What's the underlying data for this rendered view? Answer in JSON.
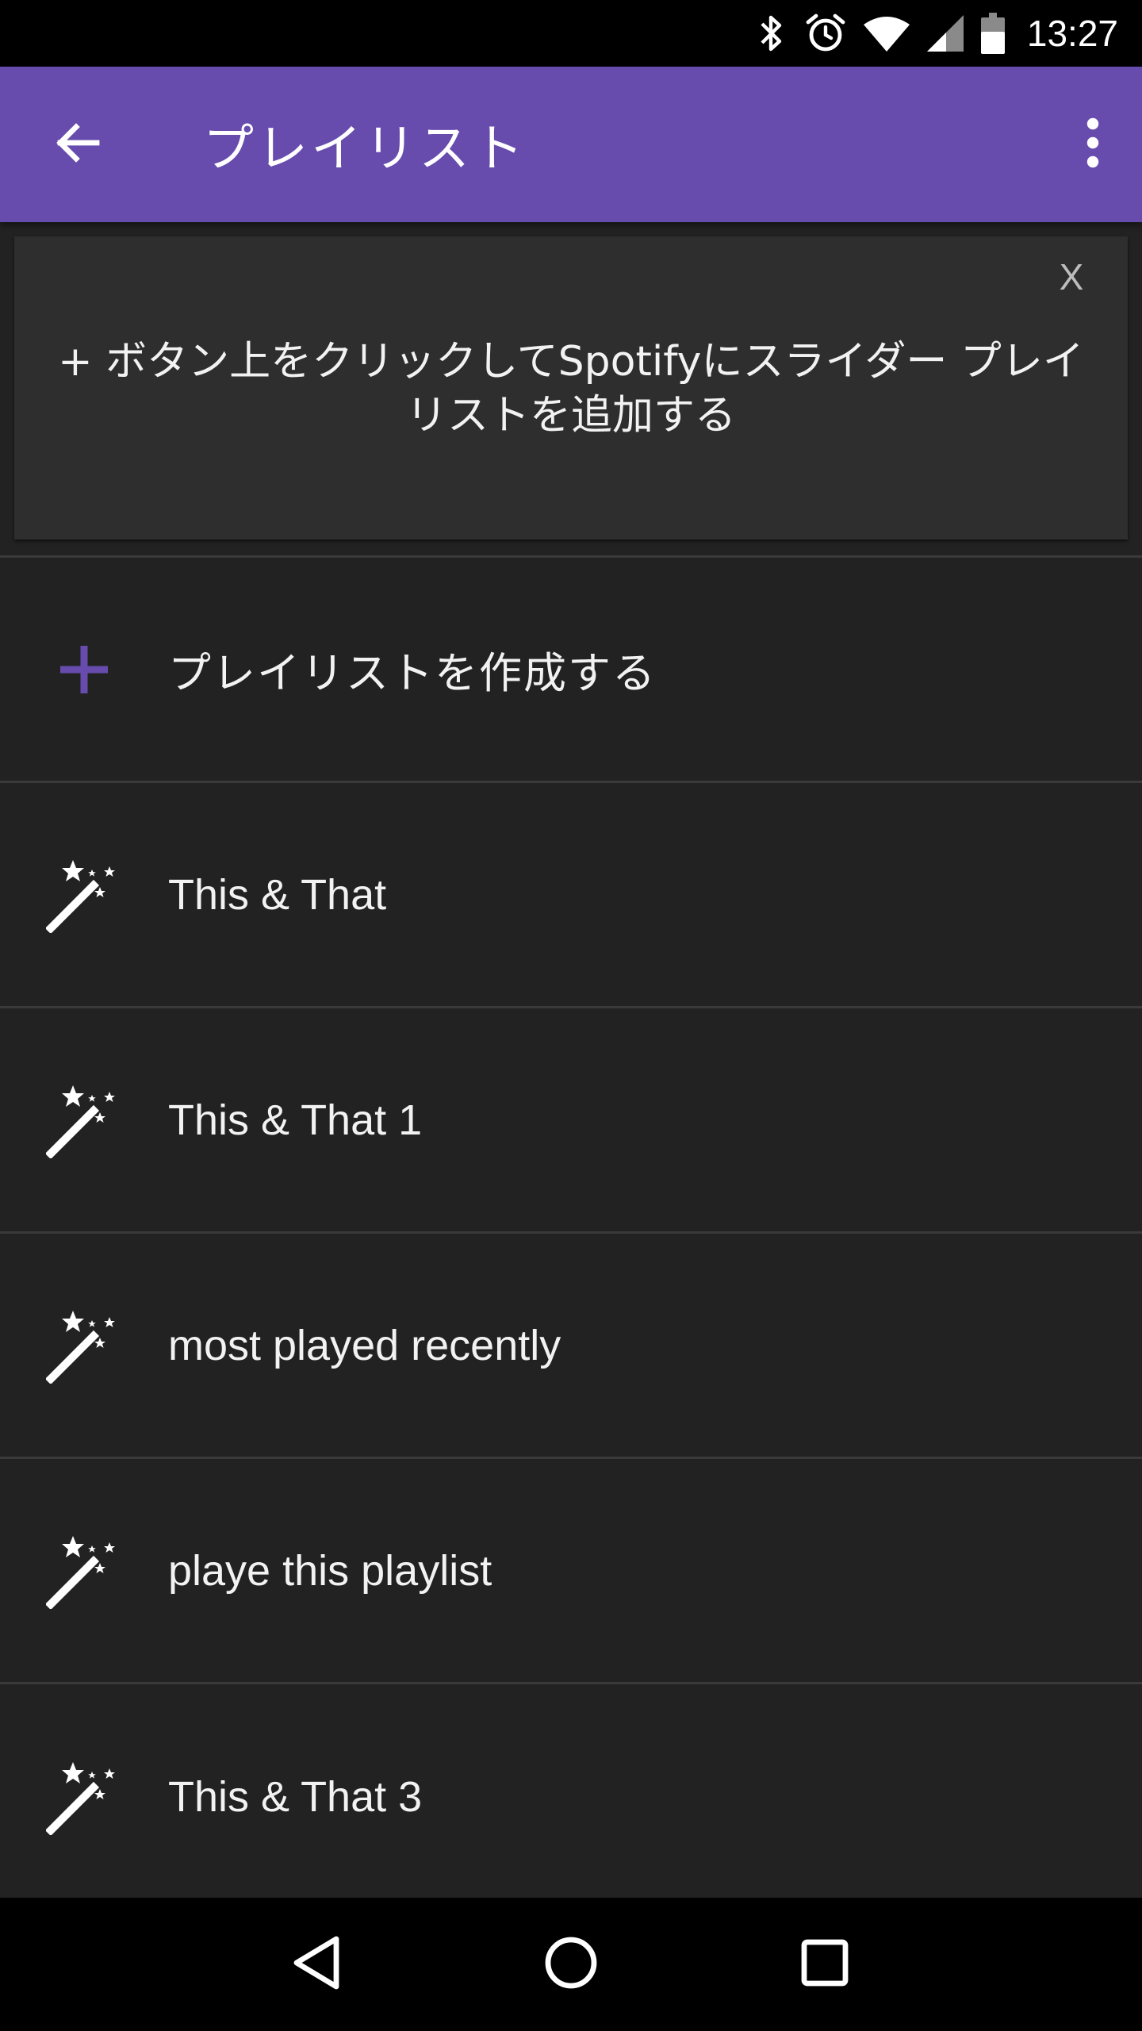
{
  "status_bar": {
    "time": "13:27",
    "icons": [
      "bluetooth-icon",
      "alarm-icon",
      "wifi-icon",
      "signal-icon",
      "battery-icon"
    ]
  },
  "app_bar": {
    "title": "プレイリスト",
    "back_icon": "arrow-back-icon",
    "menu_icon": "more-vert-icon",
    "color": "#674cae"
  },
  "hint_banner": {
    "close_label": "X",
    "text": "+ ボタン上をクリックしてSpotifyにスライダー プレイリストを追加する"
  },
  "create_row": {
    "icon": "plus-icon",
    "label": "プレイリストを作成する",
    "icon_color": "#674cae"
  },
  "playlists": [
    {
      "icon": "magic-wand-icon",
      "label": "This & That"
    },
    {
      "icon": "magic-wand-icon",
      "label": "This & That 1"
    },
    {
      "icon": "magic-wand-icon",
      "label": "most played recently"
    },
    {
      "icon": "magic-wand-icon",
      "label": "playe this playlist"
    },
    {
      "icon": "magic-wand-icon",
      "label": "This & That 3"
    }
  ],
  "nav_bar": {
    "back": "nav-back-icon",
    "home": "nav-home-icon",
    "recents": "nav-recents-icon"
  }
}
